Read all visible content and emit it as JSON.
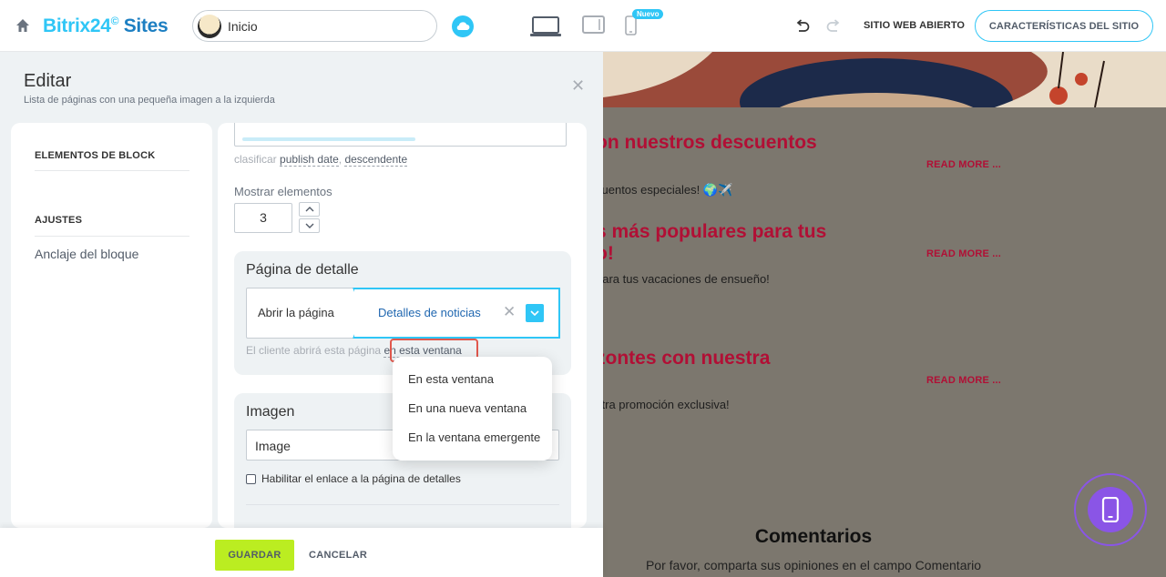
{
  "topbar": {
    "logo_main": "Bitrix24",
    "logo_mark": "©",
    "logo_sites": " Sites",
    "page_label": "Inicio",
    "new_badge": "Nuevo",
    "open_site": "SITIO WEB ABIERTO",
    "features": "CARACTERÍSTICAS DEL SITIO"
  },
  "editor": {
    "title": "Editar",
    "subtitle": "Lista de páginas con una pequeña imagen a la izquierda",
    "nav": {
      "elements_heading": "ELEMENTOS DE BLOCK",
      "settings_heading": "AJUSTES",
      "anchor_link": "Anclaje del bloque"
    },
    "sort": {
      "label": "clasificar",
      "field": "publish date",
      "comma": ",",
      "order": "descendente"
    },
    "show": {
      "label": "Mostrar elementos",
      "value": "3"
    },
    "detail": {
      "title": "Página de detalle",
      "link_left": "Abrir la página",
      "link_value": "Detalles de noticias",
      "hint_prefix": "El cliente abrirá esta página",
      "hint_link": "en esta ventana"
    },
    "image": {
      "title": "Imagen",
      "value": "Image",
      "checkbox_label": "Habilitar el enlace a la página de detalles"
    },
    "dropdown": [
      "En esta ventana",
      "En una nueva ventana",
      "En la ventana emergente"
    ],
    "footer": {
      "save": "GUARDAR",
      "cancel": "CANCELAR"
    }
  },
  "preview": {
    "items": [
      {
        "title": "on nuestros descuentos",
        "read_more": "READ MORE ...",
        "text": "cuentos especiales! 🌍✈️"
      },
      {
        "title": "s más populares para tus",
        "title2": "o!",
        "read_more": "READ MORE ...",
        "text": "para tus vacaciones de ensueño!"
      },
      {
        "title": "zontes con nuestra",
        "read_more": "READ MORE ...",
        "text": "stra promoción exclusiva!"
      }
    ],
    "comments_title": "Comentarios",
    "comments_text": "Por favor, comparta sus opiniones en el campo Comentario"
  },
  "colors": {
    "accent": "#2fc6f6",
    "save": "#bbed21",
    "preview_title": "#b10f35",
    "fab": "#8a55e6"
  }
}
